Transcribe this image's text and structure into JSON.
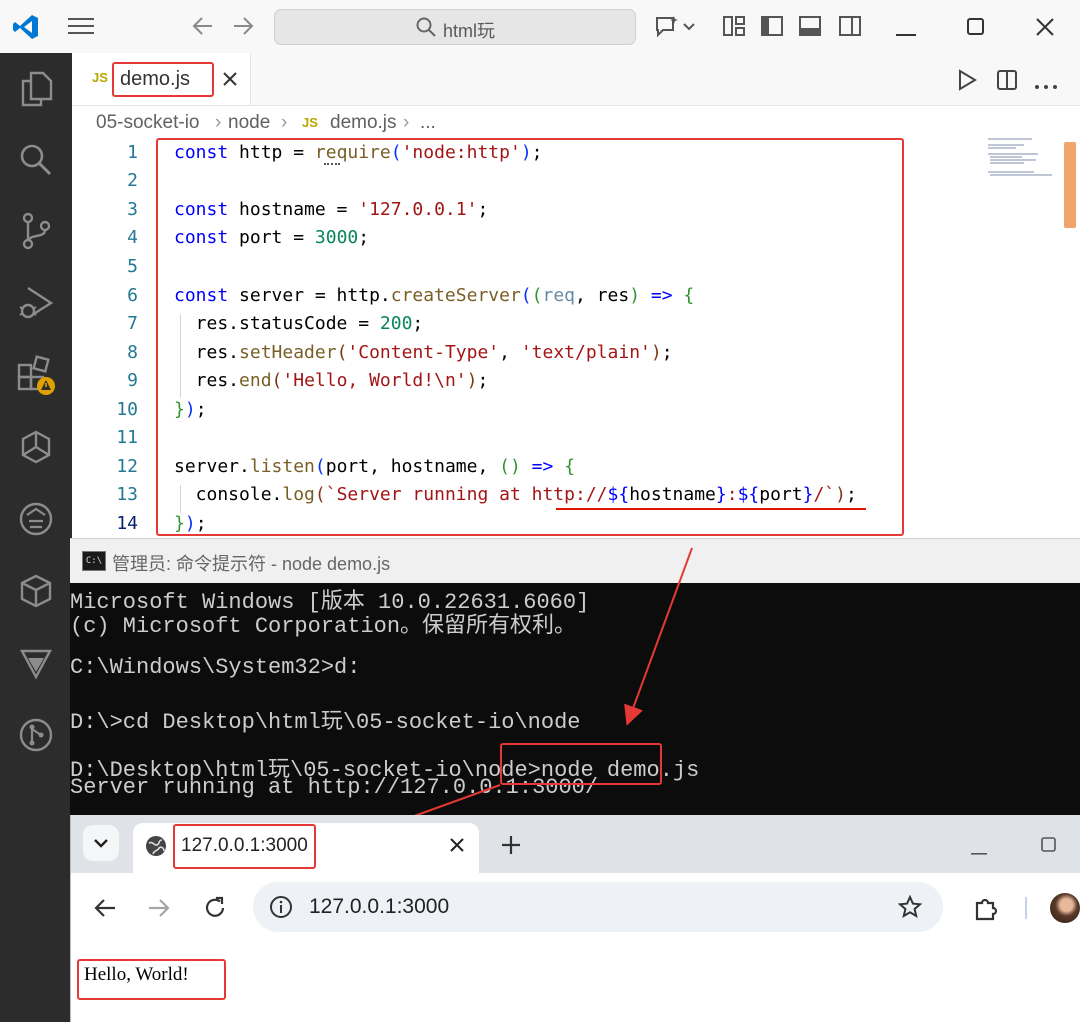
{
  "vscode": {
    "search_text": "html玩",
    "tab_label": "demo.js",
    "tab_icon_text": "JS",
    "breadcrumb": [
      "05-socket-io",
      "node",
      "demo.js",
      "..."
    ],
    "line_numbers": [
      "1",
      "2",
      "3",
      "4",
      "5",
      "6",
      "7",
      "8",
      "9",
      "10",
      "11",
      "12",
      "13",
      "14"
    ],
    "code": {
      "l1_kw": "const",
      "l1_a": " http = ",
      "l1_fn": "require",
      "l1_str": "'node:http'",
      "l3_kw": "const",
      "l3_a": " hostname = ",
      "l3_str": "'127.0.0.1'",
      "l4_kw": "const",
      "l4_a": " port = ",
      "l4_num": "3000",
      "l6_kw": "const",
      "l6_a": " server = http.",
      "l6_fn": "createServer",
      "l6_p1": "req",
      "l6_p2": "res",
      "l6_arrow": "=>",
      "l7_a": "  res.statusCode = ",
      "l7_num": "200",
      "l8_a": "  res.",
      "l8_fn": "setHeader",
      "l8_s1": "'Content-Type'",
      "l8_s2": "'text/plain'",
      "l9_a": "  res.",
      "l9_fn": "end",
      "l9_str": "'Hello, World!\\n'",
      "l12_a": "server.",
      "l12_fn": "listen",
      "l12_b": "port, hostname, ",
      "l12_arrow": "=>",
      "l13_a": "  console.",
      "l13_fn": "log",
      "l13_s1": "`Server running at http://",
      "l13_v1": "hostname",
      "l13_v2": "port",
      "l13_s2": "/`"
    }
  },
  "cmd": {
    "title": "管理员: 命令提示符 - node  demo.js",
    "icon_text": "C:\\",
    "lines": [
      "Microsoft Windows [版本 10.0.22631.6060]",
      "(c) Microsoft Corporation。保留所有权利。",
      "",
      "C:\\Windows\\System32>d:",
      "",
      "D:\\>cd Desktop\\html玩\\05-socket-io\\node",
      "",
      "D:\\Desktop\\html玩\\05-socket-io\\node>node demo.js",
      "Server running at http://127.0.0.1:3000/"
    ]
  },
  "browser": {
    "tab_title": "127.0.0.1:3000",
    "address": "127.0.0.1:3000",
    "page_text": "Hello, World!"
  },
  "colors": {
    "highlight": "#e53935",
    "activity_bar": "#2c2c2c",
    "vscode_accent": "#0078d4",
    "cmd_bg": "#0c0c0c"
  }
}
